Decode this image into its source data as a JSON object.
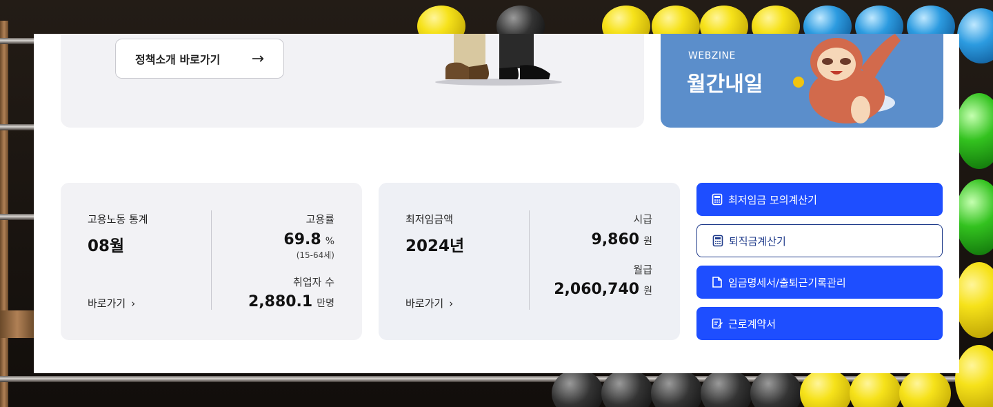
{
  "banner": {
    "policy_button_label": "정책소개 바로가기",
    "policy_button_arrow": "→"
  },
  "webzine": {
    "subtitle": "WEBZINE",
    "title": "월간내일"
  },
  "employment_card": {
    "label": "고용노동 통계",
    "period": "08월",
    "link_label": "바로가기",
    "chevron": "›",
    "rate_label": "고용률",
    "rate_value": "69.8",
    "rate_unit": "%",
    "rate_note": "(15-64세)",
    "employed_label": "취업자 수",
    "employed_value": "2,880.1",
    "employed_unit": "만명"
  },
  "wage_card": {
    "label": "최저임금액",
    "year": "2024년",
    "link_label": "바로가기",
    "chevron": "›",
    "hourly_label": "시급",
    "hourly_value": "9,860",
    "hourly_unit": "원",
    "monthly_label": "월급",
    "monthly_value": "2,060,740",
    "monthly_unit": "원"
  },
  "side_buttons": [
    {
      "label": "최저임금 모의계산기",
      "icon": "calculator-icon",
      "style": "solid"
    },
    {
      "label": "퇴직금계산기",
      "icon": "calculator-icon",
      "style": "outline"
    },
    {
      "label": "임금명세서/출퇴근기록관리",
      "icon": "document-icon",
      "style": "solid"
    },
    {
      "label": "근로계약서",
      "icon": "edit-document-icon",
      "style": "solid"
    }
  ],
  "colors": {
    "primary_blue": "#1e4eff",
    "webzine_blue": "#5b8ecb",
    "card_gray": "#f2f2f5"
  }
}
